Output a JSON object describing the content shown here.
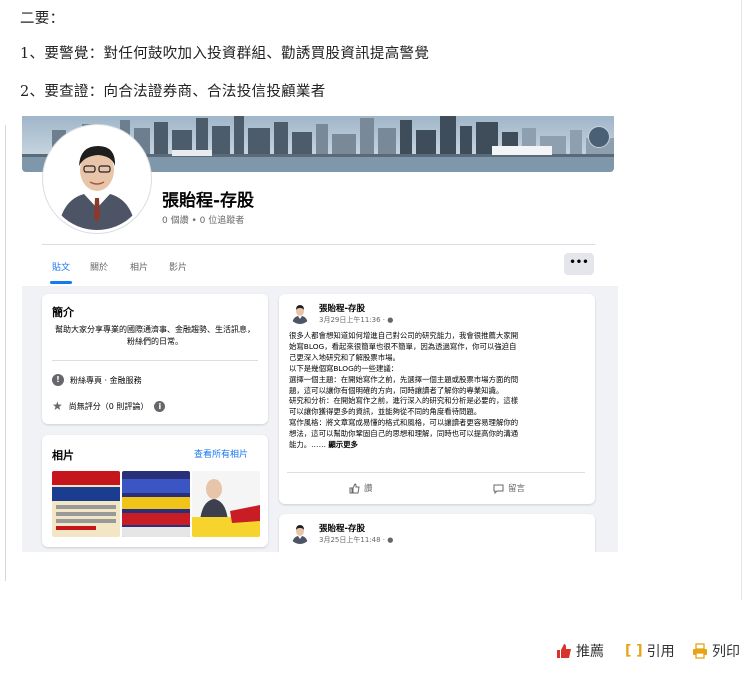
{
  "article": {
    "heading": "二要：",
    "item1": "1、要警覺：對任何鼓吹加入投資群組、勸誘買股資訊提高警覺",
    "item2": "2、要查證：向合法證券商、合法投信投顧業者"
  },
  "fb_page": {
    "name": "張貽程-存股",
    "stats": "0 個讚 • 0 位追蹤者",
    "tabs": [
      "貼文",
      "關於",
      "相片",
      "影片"
    ],
    "more": "•••",
    "intro": {
      "title": "簡介",
      "text": "幫助大家分享專業的國際通濟事、金融趨勢、生活訊息，粉絲們的日常。",
      "category": "粉絲專頁 · 金融服務",
      "rating": "尚無評分（0 則評論）"
    },
    "photos": {
      "title": "相片",
      "see_all": "查看所有相片"
    },
    "posts": [
      {
        "author": "張貽程-存股",
        "date": "3月29日上午11:36 · ",
        "lines": [
          "很多人都會想知道如何增進自己對公司的研究能力，我會很推薦大家開",
          "始寫BLOG，看起來很簡單也很不簡單，因為透過寫作，你可以強迫自",
          "己更深入地研究和了解股票市場。",
          "以下是幾個寫BLOG的一些建議：",
          "選擇一個主題：在開始寫作之前，先選擇一個主題或股票市場方面的問",
          "題，這可以讓你有個明確的方向，同時讓讀者了解你的專業知識。",
          "研究和分析：在開始寫作之前，進行深入的研究和分析是必要的，這樣",
          "可以讓你獲得更多的資訊，並能夠從不同的角度看待問題。",
          "寫作風格：將文章寫成易懂的格式和風格，可以讓讀者更容易理解你的",
          "想法，這可以幫助你鞏固自己的思想和理解，同時也可以提高你的溝通"
        ],
        "last_line": "能力。……",
        "see_more": "顯示更多",
        "like": "讚",
        "comment": "留言"
      },
      {
        "author": "張貽程-存股",
        "date": "3月25日上午11:48 · "
      }
    ]
  },
  "actions": {
    "recommend": "推薦",
    "cite": "引用",
    "print": "列印"
  }
}
